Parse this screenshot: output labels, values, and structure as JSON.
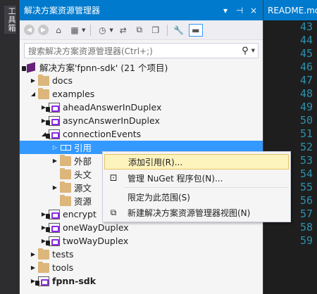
{
  "toolbox": {
    "label": "工具箱"
  },
  "solution_explorer": {
    "title": "解决方案资源管理器",
    "title_buttons": [
      "▾",
      "⊣",
      "×"
    ],
    "search_placeholder": "搜索解决方案资源管理器(Ctrl+;)",
    "toolbar_icons": [
      "back-icon",
      "forward-icon",
      "home-icon",
      "switch-views-icon",
      "pending-changes-icon",
      "sync-icon",
      "collapse-all-icon",
      "show-all-files-icon",
      "properties-icon",
      "preview-icon"
    ]
  },
  "tree": [
    {
      "label": "解决方案'fpnn-sdk' (21 个项目)",
      "icon": "solution-icon",
      "expanded": true
    },
    {
      "label": "docs",
      "icon": "folder-icon",
      "expanded": false
    },
    {
      "label": "examples",
      "icon": "folder-icon",
      "expanded": true
    },
    {
      "label": "aheadAnswerInDuplex",
      "icon": "project-icon",
      "expanded": false
    },
    {
      "label": "asyncAnswerInDuplex",
      "icon": "project-icon",
      "expanded": false
    },
    {
      "label": "connectionEvents",
      "icon": "project-icon",
      "expanded": true
    },
    {
      "label": "引用",
      "icon": "references-icon",
      "expanded": false,
      "selected": true
    },
    {
      "label": "外部",
      "icon": "external-deps-icon",
      "expanded": false
    },
    {
      "label": "头文",
      "icon": "folder-icon"
    },
    {
      "label": "源文",
      "icon": "folder-icon",
      "expanded": false
    },
    {
      "label": "资源",
      "icon": "folder-icon"
    },
    {
      "label": "encrypt",
      "icon": "project-icon",
      "expanded": false
    },
    {
      "label": "oneWayDuplex",
      "icon": "project-icon",
      "expanded": false
    },
    {
      "label": "twoWayDuplex",
      "icon": "project-icon",
      "expanded": false
    },
    {
      "label": "tests",
      "icon": "folder-icon",
      "expanded": false
    },
    {
      "label": "tools",
      "icon": "folder-icon",
      "expanded": false
    },
    {
      "label": "fpnn-sdk",
      "icon": "project-icon",
      "expanded": false,
      "bold": true
    }
  ],
  "context_menu": {
    "items": [
      {
        "label": "添加引用(R)...",
        "icon": "",
        "hover": true
      },
      {
        "label": "管理 NuGet 程序包(N)...",
        "icon": "nuget-icon"
      },
      {
        "label": "限定为此范围(S)",
        "icon": ""
      },
      {
        "label": "新建解决方案资源管理器视图(N)",
        "icon": "new-view-icon"
      }
    ]
  },
  "editor": {
    "tab_title": "README.md",
    "line_numbers": [
      "43",
      "44",
      "45",
      "46",
      "47",
      "48",
      "49",
      "50",
      "51",
      "52",
      "53",
      "54",
      "55",
      "56",
      "57",
      "58",
      "59"
    ]
  }
}
